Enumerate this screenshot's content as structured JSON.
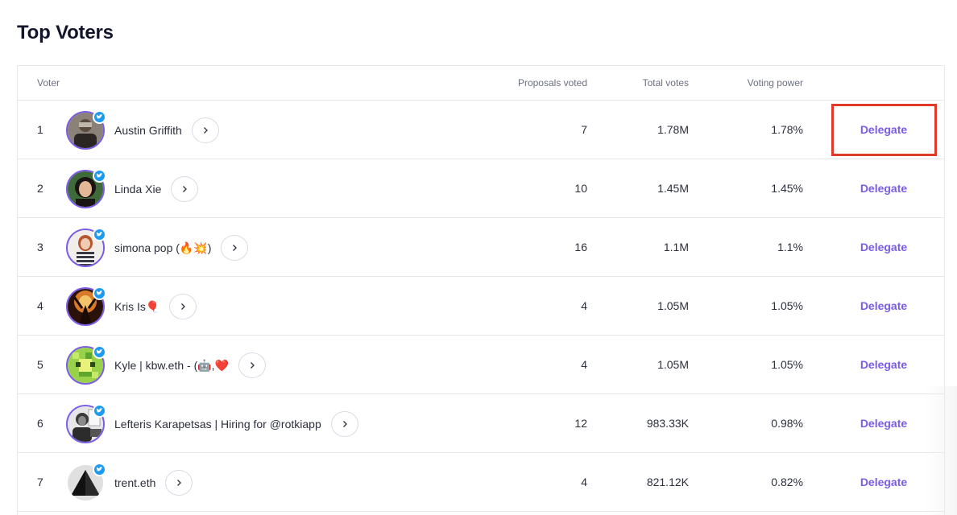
{
  "page": {
    "title": "Top Voters"
  },
  "table": {
    "headers": {
      "voter": "Voter",
      "proposals_voted": "Proposals voted",
      "total_votes": "Total votes",
      "voting_power": "Voting power"
    },
    "rows": [
      {
        "rank": "1",
        "name": "Austin Griffith",
        "proposals_voted": "7",
        "total_votes": "1.78M",
        "voting_power": "1.78%",
        "action": "Delegate",
        "avatar_icon": "avatar-austin-icon",
        "verified": true
      },
      {
        "rank": "2",
        "name": "Linda Xie",
        "proposals_voted": "10",
        "total_votes": "1.45M",
        "voting_power": "1.45%",
        "action": "Delegate",
        "avatar_icon": "avatar-linda-icon",
        "verified": true
      },
      {
        "rank": "3",
        "name": "simona pop (🔥💥)",
        "proposals_voted": "16",
        "total_votes": "1.1M",
        "voting_power": "1.1%",
        "action": "Delegate",
        "avatar_icon": "avatar-simona-icon",
        "verified": true
      },
      {
        "rank": "4",
        "name": "Kris Is🎈",
        "proposals_voted": "4",
        "total_votes": "1.05M",
        "voting_power": "1.05%",
        "action": "Delegate",
        "avatar_icon": "avatar-kris-icon",
        "verified": true
      },
      {
        "rank": "5",
        "name": "Kyle | kbw.eth - (🤖,❤️",
        "proposals_voted": "4",
        "total_votes": "1.05M",
        "voting_power": "1.05%",
        "action": "Delegate",
        "avatar_icon": "avatar-kyle-icon",
        "verified": true
      },
      {
        "rank": "6",
        "name": "Lefteris Karapetsas | Hiring for @rotkiapp",
        "proposals_voted": "12",
        "total_votes": "983.33K",
        "voting_power": "0.98%",
        "action": "Delegate",
        "avatar_icon": "avatar-lefteris-icon",
        "verified": true
      },
      {
        "rank": "7",
        "name": "trent.eth",
        "proposals_voted": "4",
        "total_votes": "821.12K",
        "voting_power": "0.82%",
        "action": "Delegate",
        "avatar_icon": "avatar-trent-icon",
        "verified": true
      }
    ]
  },
  "colors": {
    "accent": "#7b5ce6",
    "verified_badge": "#1d9bf0",
    "highlight": "#e23a2a",
    "title": "#13152b"
  },
  "icons": {
    "verified": "twitter-bird-icon",
    "row_action": "chevron-right-icon"
  }
}
